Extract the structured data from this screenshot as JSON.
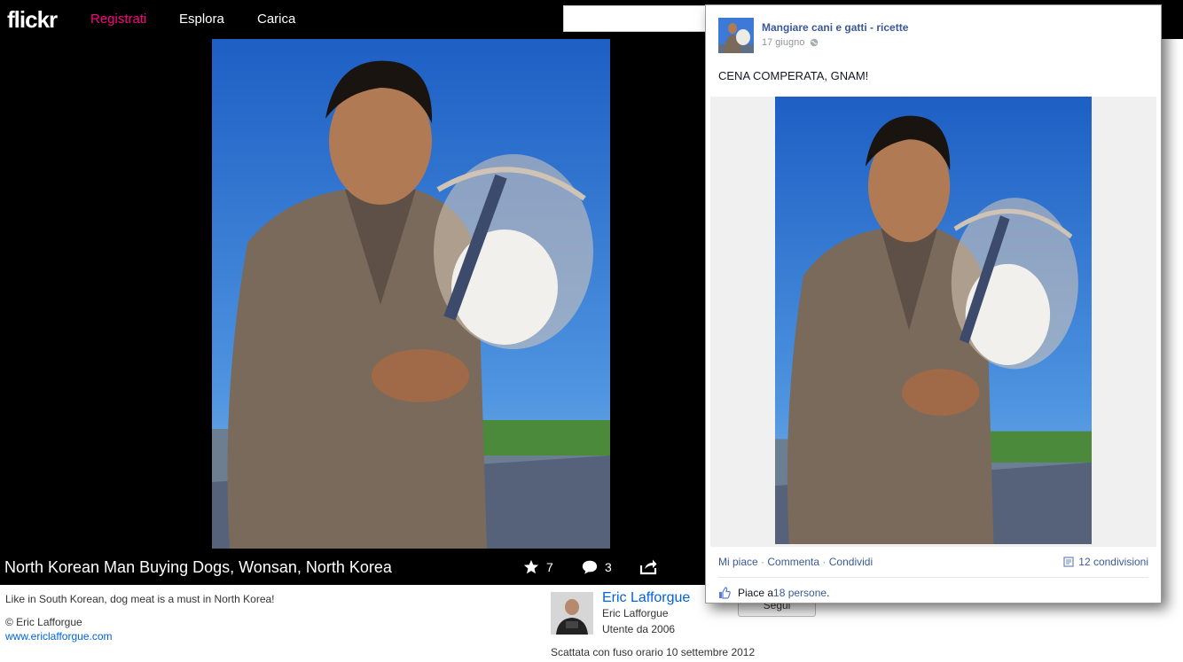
{
  "flickr": {
    "logo": "flickr",
    "nav": {
      "register": "Registrati",
      "explore": "Esplora",
      "upload": "Carica"
    },
    "search": {
      "value": "",
      "placeholder": ""
    },
    "photo": {
      "title": "North Korean Man Buying Dogs, Wonsan, North Korea",
      "faves": "7",
      "comments": "3",
      "description": "Like in South Korean, dog meat is a must in North Korea!",
      "copyright": "© Eric Lafforgue",
      "website": "www.ericlafforgue.com"
    },
    "author": {
      "link_name": "Eric Lafforgue",
      "name": "Eric Lafforgue",
      "member_since": "Utente da 2006",
      "follow_label": "Segui"
    },
    "taken_timezone": "Scattata con fuso orario 10 settembre 2012",
    "colors": {
      "accent": "#ff0084",
      "link": "#0063dc",
      "background": "#000000"
    }
  },
  "facebook_post": {
    "page_name": "Mangiare cani e gatti - ricette",
    "date": "17 giugno",
    "text": "CENA COMPERATA, GNAM!",
    "actions": {
      "like": "Mi piace",
      "comment": "Commenta",
      "share": "Condividi",
      "separator": "·"
    },
    "shares": "12 condivisioni",
    "likes": {
      "prefix": "Piace a ",
      "count_link": "18 persone",
      "suffix": "."
    },
    "colors": {
      "link": "#3b5998",
      "muted": "#90949c"
    }
  }
}
